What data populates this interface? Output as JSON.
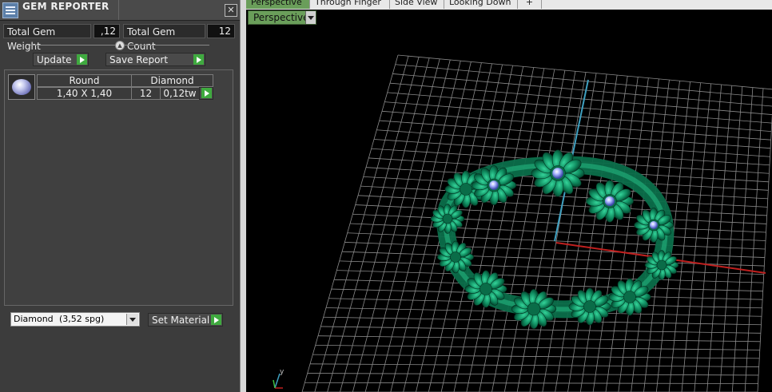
{
  "panel": {
    "title": "GEM REPORTER",
    "total_weight_label": "Total Gem Weight",
    "total_weight_value": ",12",
    "total_count_label": "Total Gem Count",
    "total_count_value": "12",
    "update_label": "Update",
    "save_report_label": "Save Report",
    "gem_row": {
      "shape": "Round",
      "material": "Diamond",
      "size": "1,40 X 1,40",
      "count": "12",
      "weight": "0,12tw"
    },
    "material_select": {
      "name": "Diamond",
      "detail": "(3,52 spg)"
    },
    "set_material_label": "Set Material"
  },
  "viewport": {
    "tabs": [
      "Perspective",
      "Through Finger",
      "Side View",
      "Looking Down",
      "+"
    ],
    "active_tab": 0,
    "view_mode": "Perspective",
    "axis_label_y": "y"
  },
  "colors": {
    "panel_bg": "#3c3c3c",
    "accent_green": "#3faa3f",
    "tab_active": "#6a9e5a",
    "ring_color": "#0f8a5e",
    "axis_x": "#c0201f",
    "axis_y": "#3fa0c0"
  }
}
